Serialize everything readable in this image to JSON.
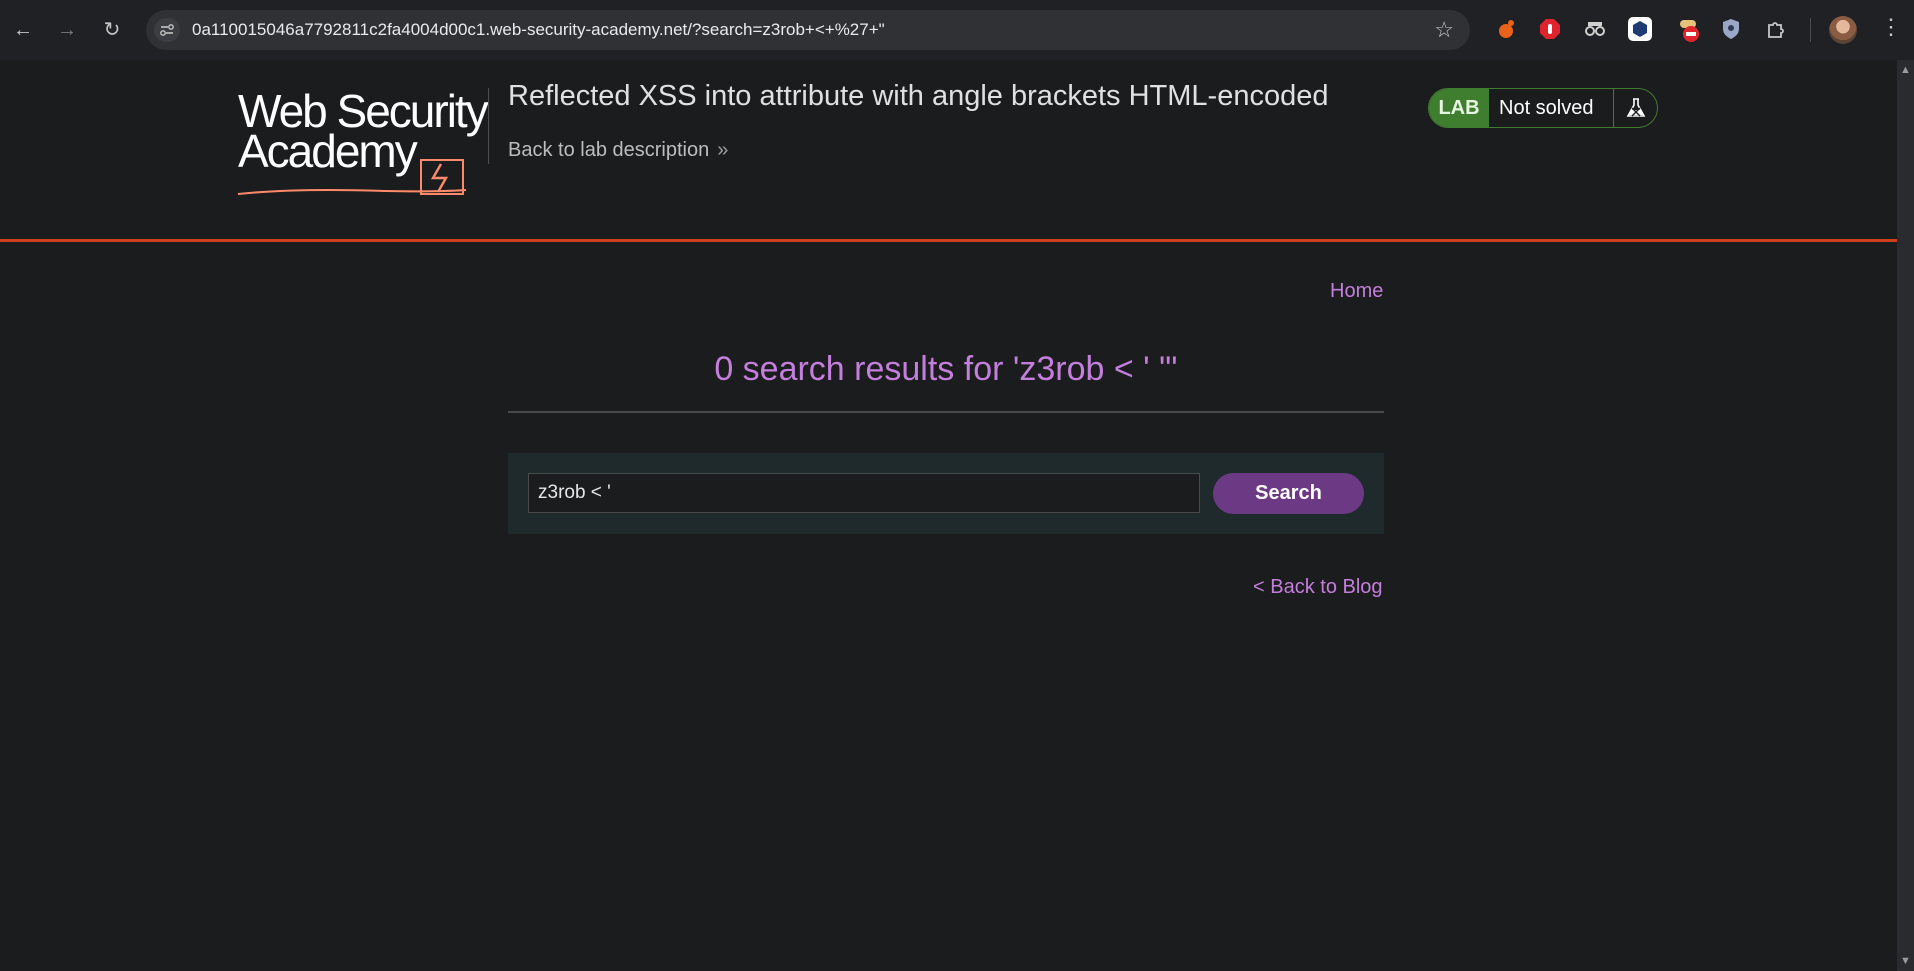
{
  "browser": {
    "url": "0a110015046a7792811c2fa4004d00c1.web-security-academy.net/?search=z3rob+<+%27+\"",
    "icons": [
      "back-arrow-icon",
      "forward-arrow-icon",
      "reload-icon",
      "site-info-icon",
      "bookmark-star-icon",
      "extensions-puzzle-icon",
      "profile-avatar",
      "more-menu-icon"
    ],
    "extension_colors": [
      "#e8621a",
      "#e0242e",
      "#d0d0d0",
      "#ffffff",
      "#e0242e",
      "#9aa7c7"
    ]
  },
  "header": {
    "logo_line1": "Web Security",
    "logo_line2": "Academy",
    "lab_title": "Reflected XSS into attribute with angle brackets HTML-encoded",
    "back_to_description": "Back to lab description",
    "lab_badge": "LAB",
    "status": "Not solved",
    "accent_color": "#ce3f1c"
  },
  "main": {
    "home_link": "Home",
    "results_heading": "0 search results for 'z3rob < ' \"'",
    "search_value": "z3rob < '",
    "search_button": "Search",
    "back_to_blog": "< Back to Blog",
    "link_color": "#c47edb"
  }
}
